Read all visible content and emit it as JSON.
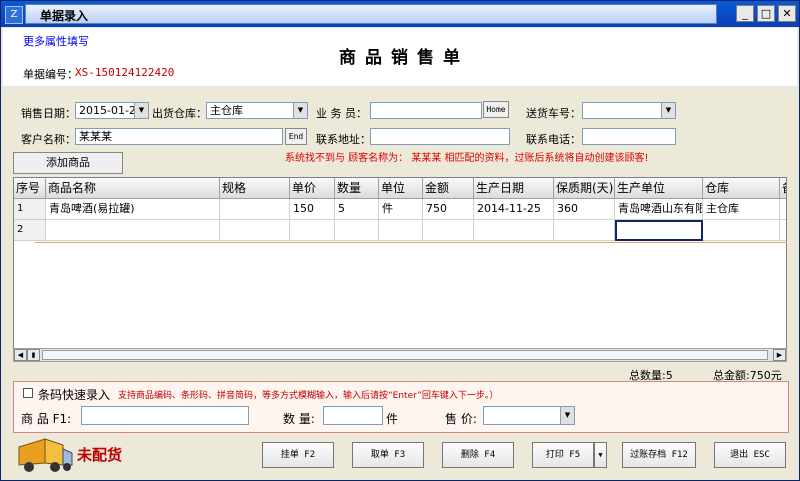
{
  "window": {
    "title": "单据录入",
    "minimize_label": "_",
    "maximize_label": "□",
    "close_label": "✕"
  },
  "header": {
    "more_link": "更多属性填写",
    "doc_title": "商品销售单",
    "doc_no_label": "单据编号：",
    "doc_no_value": "XS-150124122420"
  },
  "form": {
    "sale_date_label": "销售日期：",
    "sale_date_value": "2015-01-24",
    "warehouse_label": "出货仓库：",
    "warehouse_value": "主仓库",
    "salesman_label": "业 务 员：",
    "salesman_value": "",
    "home_button": "Home",
    "truck_no_label": "送货车号：",
    "truck_no_value": "",
    "customer_label": "客户名称：",
    "customer_value": "某某某",
    "end_button": "End",
    "address_label": "联系地址：",
    "address_value": "",
    "phone_label": "联系电话：",
    "phone_value": "",
    "hint": "系统找不到与 顾客名称为： 某某某 相匹配的资料，过账后系统将自动创建该顾客!",
    "add_product_button": "添加商品"
  },
  "grid": {
    "headers": [
      "序号",
      "商品名称",
      "规格",
      "单价",
      "数量",
      "单位",
      "金额",
      "生产日期",
      "保质期(天)",
      "生产单位",
      "仓库",
      "备"
    ],
    "rows": [
      [
        "1",
        "青岛啤酒(易拉罐)",
        "",
        "150",
        "5",
        "件",
        "750",
        "2014-11-25",
        "360",
        "青岛啤酒山东有限公司",
        "主仓库",
        ""
      ],
      [
        "2",
        "",
        "",
        "",
        "",
        "",
        "",
        "",
        "",
        "",
        "",
        ""
      ]
    ]
  },
  "totals": {
    "quantity": "总数量:5",
    "amount": "总金额:750元"
  },
  "quick_entry": {
    "checkbox_label": "条码快速录入",
    "hint": "支持商品编码、条形码、拼音简码，等多方式模糊输入，输入后请按“Enter”回车键入下一步。）",
    "product_label": "商 品 F1:",
    "product_value": "",
    "qty_label": "数 量:",
    "qty_value": "",
    "qty_unit": "件",
    "price_label": "售 价:",
    "price_value": ""
  },
  "footer": {
    "status": "未配货",
    "buttons": {
      "hold": "挂单 F2",
      "retrieve": "取单 F3",
      "delete": "删除 F4",
      "print": "打印 F5",
      "post": "过账存档 F12",
      "exit": "退出 ESC"
    }
  }
}
